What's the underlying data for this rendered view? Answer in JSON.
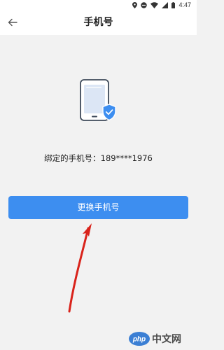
{
  "status_bar": {
    "time": "4:47",
    "icons": [
      "location-icon",
      "do-not-disturb-icon",
      "wifi-icon",
      "cellular-signal-icon",
      "battery-icon"
    ]
  },
  "header": {
    "title": "手机号",
    "back_icon": "back-arrow-icon"
  },
  "illustration": {
    "icon": "phone-verified-icon",
    "accent_color": "#3d8ef0"
  },
  "main": {
    "bound_phone_label": "绑定的手机号：",
    "bound_phone_number": "189****1976",
    "change_button_label": "更换手机号"
  },
  "colors": {
    "primary": "#3d8ef0",
    "background": "#f2f2f2",
    "annotation": "#d9231b"
  },
  "watermark": {
    "brand_logo": "php",
    "text": "中文网"
  }
}
